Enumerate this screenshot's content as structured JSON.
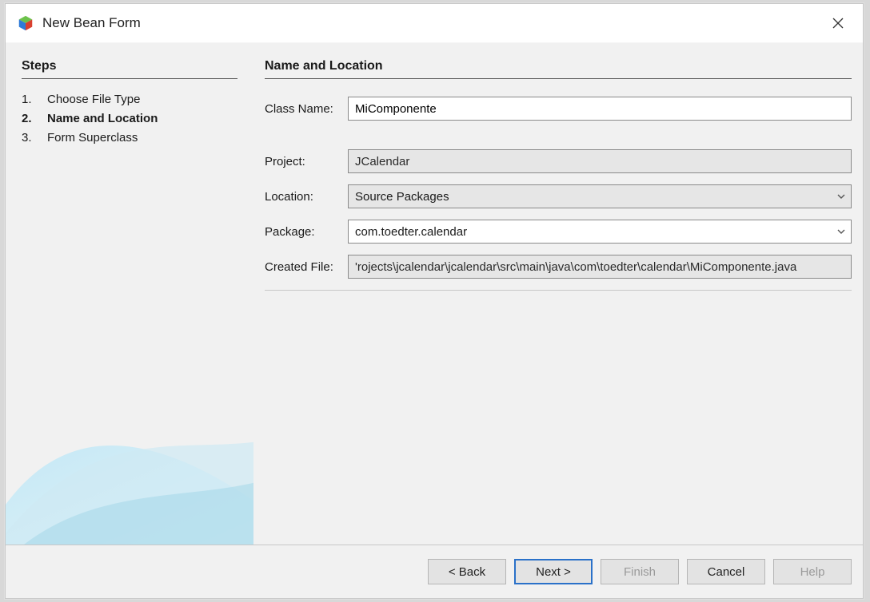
{
  "window": {
    "title": "New Bean Form"
  },
  "sidebar": {
    "steps_header": "Steps",
    "steps": [
      {
        "num": "1.",
        "label": "Choose File Type",
        "current": false
      },
      {
        "num": "2.",
        "label": "Name and Location",
        "current": true
      },
      {
        "num": "3.",
        "label": "Form Superclass",
        "current": false
      }
    ]
  },
  "main": {
    "header": "Name and Location",
    "labels": {
      "class_name": "Class Name:",
      "project": "Project:",
      "location": "Location:",
      "package": "Package:",
      "created_file": "Created File:"
    },
    "values": {
      "class_name": "MiComponente",
      "project": "JCalendar",
      "location": "Source Packages",
      "package": "com.toedter.calendar",
      "created_file": "'rojects\\jcalendar\\jcalendar\\src\\main\\java\\com\\toedter\\calendar\\MiComponente.java"
    }
  },
  "footer": {
    "back": "< Back",
    "next": "Next >",
    "finish": "Finish",
    "cancel": "Cancel",
    "help": "Help"
  }
}
